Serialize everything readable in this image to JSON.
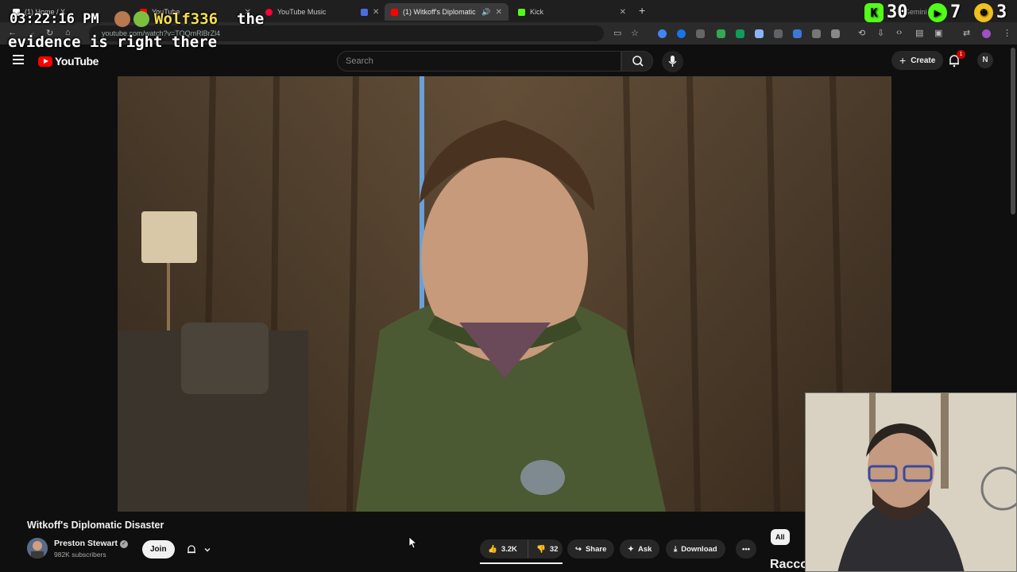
{
  "browser": {
    "tabs": [
      {
        "title": "(1) Home / X",
        "favicon_color": "#ffffff",
        "active": false
      },
      {
        "title": "YouTube",
        "favicon_color": "#ff0000",
        "active": false
      },
      {
        "title": "YouTube Music",
        "favicon_color": "#ff0033",
        "active": false
      },
      {
        "title": "",
        "favicon_color": "#4a6ee0",
        "active": false
      },
      {
        "title": "(1) Witkoff's Diplomatic Di",
        "favicon_color": "#ff0000",
        "active": true
      },
      {
        "title": "Kick",
        "favicon_color": "#53fc18",
        "active": false
      }
    ],
    "url": "youtube.com/watch?v=TOQmRlBrZl4"
  },
  "overlay": {
    "clock": "03:22:16 PM",
    "chat_user": "Wolf336",
    "chat_text_1": "the",
    "chat_text_2": "evidence is right there",
    "counter_kick": "30",
    "counter_play": "7",
    "counter_face": "3",
    "tab_clip_text": "Gemini"
  },
  "masthead": {
    "logo_text": "YouTube",
    "search_placeholder": "Search",
    "create_label": "Create",
    "notification_count": "1",
    "avatar_letter": "N"
  },
  "video": {
    "title": "Witkoff's Diplomatic Disaster",
    "channel": "Preston Stewart",
    "subscribers": "982K subscribers",
    "join_label": "Join",
    "likes": "3.2K",
    "dislikes": "32",
    "share_label": "Share",
    "ask_label": "Ask",
    "download_label": "Download"
  },
  "sidebar": {
    "chip_all": "All",
    "next_title_partial": "Racco"
  },
  "colors": {
    "yt_red": "#ff0000",
    "bg": "#0f0f0f",
    "pill": "#272727"
  }
}
